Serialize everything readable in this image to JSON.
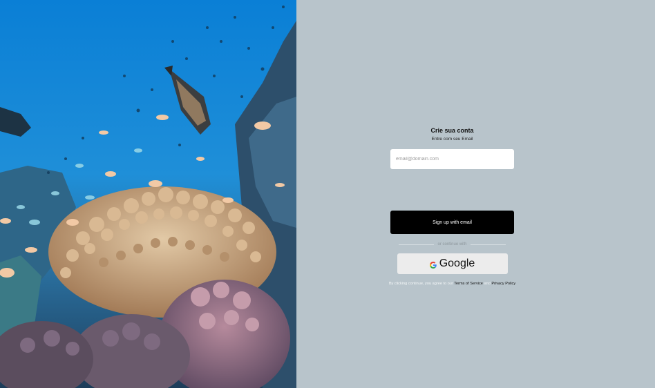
{
  "signup": {
    "title": "Crie sua conta",
    "subtitle": "Entre com seu Email",
    "email_placeholder": "email@domain.com",
    "email_value": "",
    "submit_label": "Sign up with email",
    "divider_text": "or continue with",
    "google_label": "Google",
    "legal_prefix": "By clicking continue, you agree to our",
    "terms_label": "Terms of Service",
    "legal_and": "and",
    "privacy_label": "Privacy Policy"
  },
  "colors": {
    "right_background": "#b8c4cb",
    "primary_button": "#000000",
    "google_button": "#ececec"
  },
  "icons": [
    "google-icon"
  ]
}
